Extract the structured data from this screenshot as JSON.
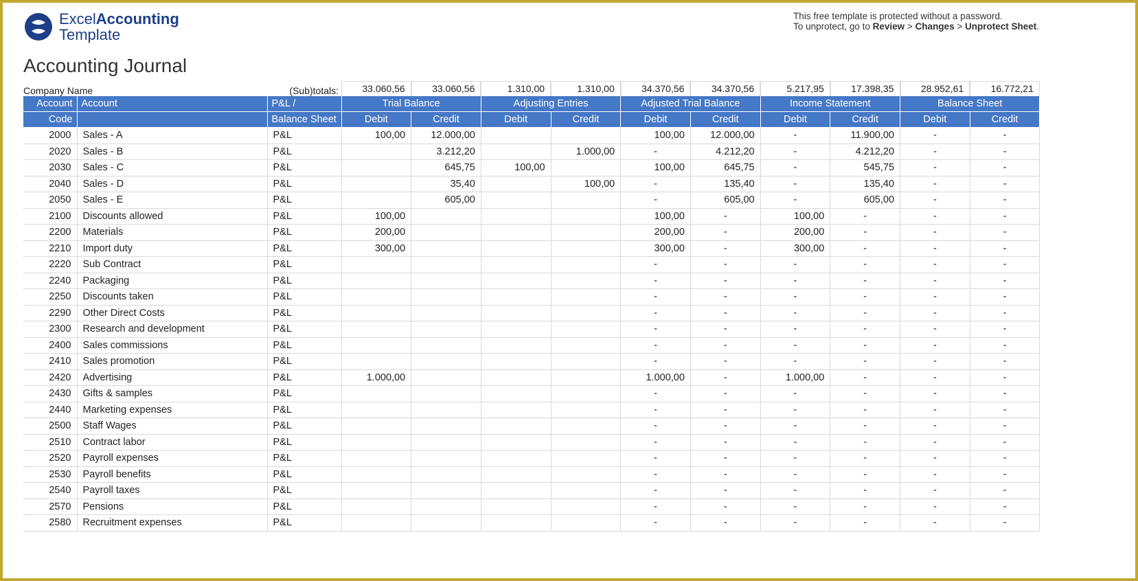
{
  "logo": {
    "line1a": "Excel",
    "line1b": "Accounting",
    "line2": "Template"
  },
  "protect": {
    "line1": "This free template is protected without a password.",
    "line2a": "To unprotect, go to ",
    "review": "Review",
    "sep": " > ",
    "changes": "Changes",
    "unprotect": "Unprotect Sheet",
    "dot": "."
  },
  "title": "Accounting Journal",
  "company_label": "Company Name",
  "subtotals_label": "(Sub)totals:",
  "subtotals": [
    "33.060,56",
    "33.060,56",
    "1.310,00",
    "1.310,00",
    "34.370,56",
    "34.370,56",
    "5.217,95",
    "17.398,35",
    "28.952,61",
    "16.772,21"
  ],
  "header1": {
    "account_code": "Account",
    "account": "Account",
    "pl": "P&L /",
    "groups": [
      "Trial Balance",
      "Adjusting Entries",
      "Adjusted Trial Balance",
      "Income Statement",
      "Balance Sheet"
    ]
  },
  "header2": {
    "code": "Code",
    "account_blank": "",
    "pl": "Balance Sheet",
    "debit": "Debit",
    "credit": "Credit"
  },
  "rows": [
    {
      "code": "2000",
      "acct": "Sales - A",
      "pl": "P&L",
      "v": [
        "100,00",
        "12.000,00",
        "",
        "",
        "100,00",
        "12.000,00",
        "-",
        "11.900,00",
        "-",
        "-"
      ]
    },
    {
      "code": "2020",
      "acct": "Sales - B",
      "pl": "P&L",
      "v": [
        "",
        "3.212,20",
        "",
        "1.000,00",
        "-",
        "4.212,20",
        "-",
        "4.212,20",
        "-",
        "-"
      ]
    },
    {
      "code": "2030",
      "acct": "Sales - C",
      "pl": "P&L",
      "v": [
        "",
        "645,75",
        "100,00",
        "",
        "100,00",
        "645,75",
        "-",
        "545,75",
        "-",
        "-"
      ]
    },
    {
      "code": "2040",
      "acct": "Sales - D",
      "pl": "P&L",
      "v": [
        "",
        "35,40",
        "",
        "100,00",
        "-",
        "135,40",
        "-",
        "135,40",
        "-",
        "-"
      ]
    },
    {
      "code": "2050",
      "acct": "Sales - E",
      "pl": "P&L",
      "v": [
        "",
        "605,00",
        "",
        "",
        "-",
        "605,00",
        "-",
        "605,00",
        "-",
        "-"
      ]
    },
    {
      "code": "2100",
      "acct": "Discounts allowed",
      "pl": "P&L",
      "v": [
        "100,00",
        "",
        "",
        "",
        "100,00",
        "-",
        "100,00",
        "-",
        "-",
        "-"
      ]
    },
    {
      "code": "2200",
      "acct": "Materials",
      "pl": "P&L",
      "v": [
        "200,00",
        "",
        "",
        "",
        "200,00",
        "-",
        "200,00",
        "-",
        "-",
        "-"
      ]
    },
    {
      "code": "2210",
      "acct": "Import duty",
      "pl": "P&L",
      "v": [
        "300,00",
        "",
        "",
        "",
        "300,00",
        "-",
        "300,00",
        "-",
        "-",
        "-"
      ]
    },
    {
      "code": "2220",
      "acct": "Sub Contract",
      "pl": "P&L",
      "v": [
        "",
        "",
        "",
        "",
        "-",
        "-",
        "-",
        "-",
        "-",
        "-"
      ]
    },
    {
      "code": "2240",
      "acct": "Packaging",
      "pl": "P&L",
      "v": [
        "",
        "",
        "",
        "",
        "-",
        "-",
        "-",
        "-",
        "-",
        "-"
      ]
    },
    {
      "code": "2250",
      "acct": "Discounts taken",
      "pl": "P&L",
      "v": [
        "",
        "",
        "",
        "",
        "-",
        "-",
        "-",
        "-",
        "-",
        "-"
      ]
    },
    {
      "code": "2290",
      "acct": "Other Direct Costs",
      "pl": "P&L",
      "v": [
        "",
        "",
        "",
        "",
        "-",
        "-",
        "-",
        "-",
        "-",
        "-"
      ]
    },
    {
      "code": "2300",
      "acct": "Research and development",
      "pl": "P&L",
      "v": [
        "",
        "",
        "",
        "",
        "-",
        "-",
        "-",
        "-",
        "-",
        "-"
      ]
    },
    {
      "code": "2400",
      "acct": "Sales commissions",
      "pl": "P&L",
      "v": [
        "",
        "",
        "",
        "",
        "-",
        "-",
        "-",
        "-",
        "-",
        "-"
      ]
    },
    {
      "code": "2410",
      "acct": "Sales promotion",
      "pl": "P&L",
      "v": [
        "",
        "",
        "",
        "",
        "-",
        "-",
        "-",
        "-",
        "-",
        "-"
      ]
    },
    {
      "code": "2420",
      "acct": "Advertising",
      "pl": "P&L",
      "v": [
        "1.000,00",
        "",
        "",
        "",
        "1.000,00",
        "-",
        "1.000,00",
        "-",
        "-",
        "-"
      ]
    },
    {
      "code": "2430",
      "acct": "Gifts & samples",
      "pl": "P&L",
      "v": [
        "",
        "",
        "",
        "",
        "-",
        "-",
        "-",
        "-",
        "-",
        "-"
      ]
    },
    {
      "code": "2440",
      "acct": "Marketing expenses",
      "pl": "P&L",
      "v": [
        "",
        "",
        "",
        "",
        "-",
        "-",
        "-",
        "-",
        "-",
        "-"
      ]
    },
    {
      "code": "2500",
      "acct": "Staff Wages",
      "pl": "P&L",
      "v": [
        "",
        "",
        "",
        "",
        "-",
        "-",
        "-",
        "-",
        "-",
        "-"
      ]
    },
    {
      "code": "2510",
      "acct": "Contract labor",
      "pl": "P&L",
      "v": [
        "",
        "",
        "",
        "",
        "-",
        "-",
        "-",
        "-",
        "-",
        "-"
      ]
    },
    {
      "code": "2520",
      "acct": "Payroll expenses",
      "pl": "P&L",
      "v": [
        "",
        "",
        "",
        "",
        "-",
        "-",
        "-",
        "-",
        "-",
        "-"
      ]
    },
    {
      "code": "2530",
      "acct": "Payroll benefits",
      "pl": "P&L",
      "v": [
        "",
        "",
        "",
        "",
        "-",
        "-",
        "-",
        "-",
        "-",
        "-"
      ]
    },
    {
      "code": "2540",
      "acct": "Payroll taxes",
      "pl": "P&L",
      "v": [
        "",
        "",
        "",
        "",
        "-",
        "-",
        "-",
        "-",
        "-",
        "-"
      ]
    },
    {
      "code": "2570",
      "acct": "Pensions",
      "pl": "P&L",
      "v": [
        "",
        "",
        "",
        "",
        "-",
        "-",
        "-",
        "-",
        "-",
        "-"
      ]
    },
    {
      "code": "2580",
      "acct": "Recruitment expenses",
      "pl": "P&L",
      "v": [
        "",
        "",
        "",
        "",
        "-",
        "-",
        "-",
        "-",
        "-",
        "-"
      ]
    }
  ]
}
